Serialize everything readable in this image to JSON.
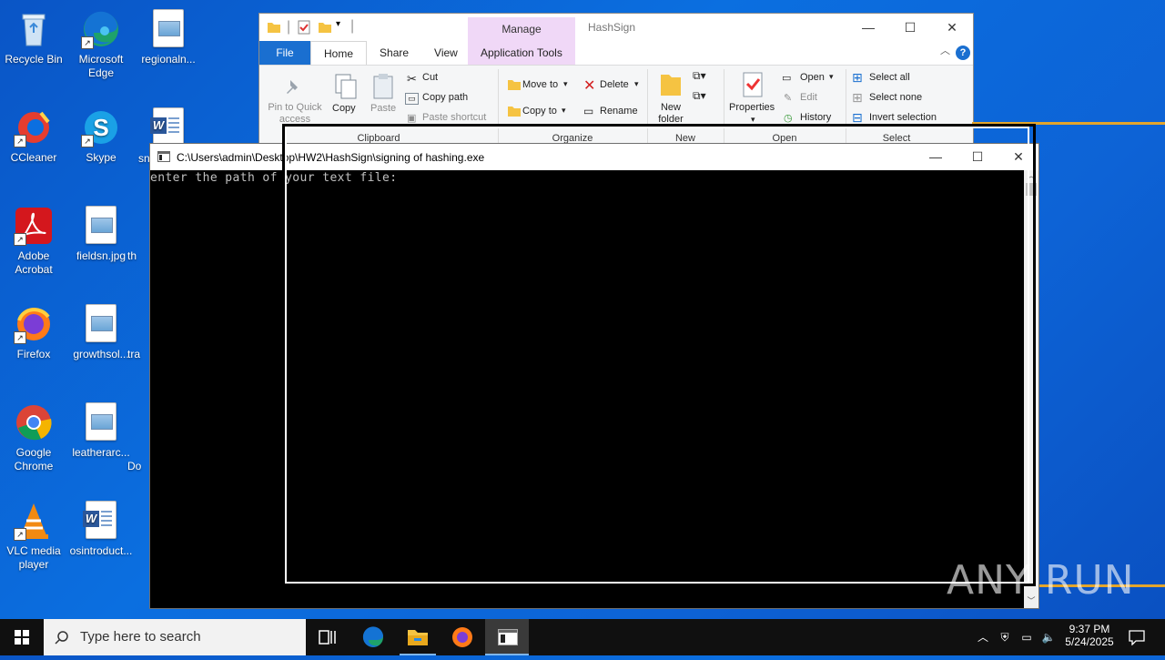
{
  "desktop": {
    "icons": [
      {
        "label": "Recycle Bin"
      },
      {
        "label": "Microsoft Edge"
      },
      {
        "label": "regionaln..."
      },
      {
        "label": "CCleaner"
      },
      {
        "label": "Skype"
      },
      {
        "label": "sn"
      },
      {
        "label": "Adobe Acrobat"
      },
      {
        "label": "fieldsn.jpg"
      },
      {
        "label": "th"
      },
      {
        "label": "Firefox"
      },
      {
        "label": "growthsol..."
      },
      {
        "label": "tra"
      },
      {
        "label": "Google Chrome"
      },
      {
        "label": "leatherarc..."
      },
      {
        "label": "Do"
      },
      {
        "label": "VLC media player"
      },
      {
        "label": "osintroduct..."
      }
    ]
  },
  "explorer": {
    "title": "HashSign",
    "context_tab_header": "Manage",
    "tabs": [
      "File",
      "Home",
      "Share",
      "View",
      "Application Tools"
    ],
    "clipboard": {
      "pin": "Pin to Quick access",
      "copy": "Copy",
      "paste": "Paste",
      "cut": "Cut",
      "copy_path": "Copy path",
      "paste_shortcut": "Paste shortcut",
      "group": "Clipboard"
    },
    "organize": {
      "move_to": "Move to",
      "copy_to": "Copy to",
      "delete": "Delete",
      "rename": "Rename",
      "group": "Organize"
    },
    "new": {
      "new_folder": "New folder",
      "group": "New"
    },
    "open": {
      "properties": "Properties",
      "open": "Open",
      "edit": "Edit",
      "history": "History",
      "group": "Open"
    },
    "select": {
      "select_all": "Select all",
      "select_none": "Select none",
      "invert": "Invert selection",
      "group": "Select"
    }
  },
  "console": {
    "title": "C:\\Users\\admin\\Desktop\\HW2\\HashSign\\signing of hashing.exe",
    "output": "enter the path of your text file:"
  },
  "watermark": "ANY RUN",
  "taskbar": {
    "search_placeholder": "Type here to search",
    "time": "9:37 PM",
    "date": "5/24/2025"
  },
  "colors": {
    "desktop_bg": "#0b6fe0",
    "file_tab": "#1a6fd0",
    "manage_tab": "#f0d8f7",
    "console_bg": "#000000",
    "taskbar_bg": "#101010"
  }
}
